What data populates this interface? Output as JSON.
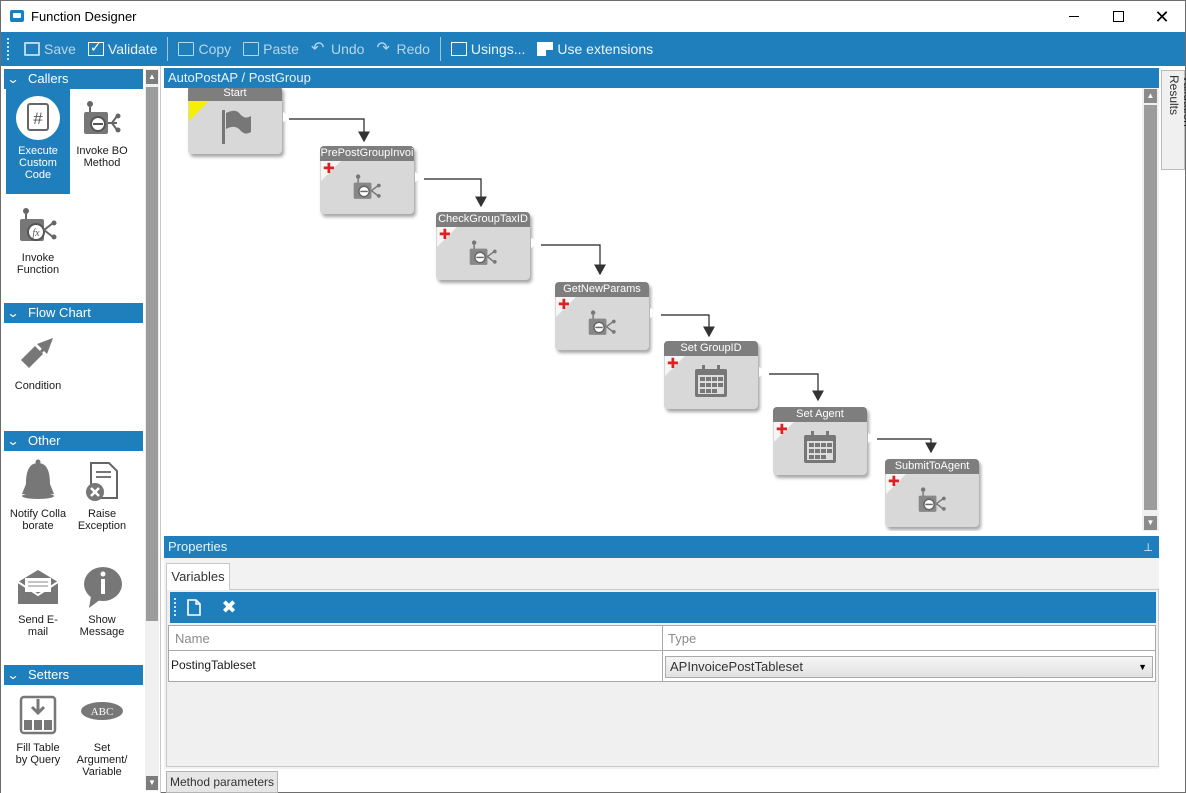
{
  "window": {
    "title": "Function Designer"
  },
  "toolbar": {
    "save": "Save",
    "validate": "Validate",
    "copy": "Copy",
    "paste": "Paste",
    "undo": "Undo",
    "redo": "Redo",
    "usings": "Usings...",
    "use_extensions": "Use extensions"
  },
  "toolbox": {
    "sections": {
      "callers": "Callers",
      "flow_chart": "Flow Chart",
      "other": "Other",
      "setters": "Setters"
    },
    "tools": {
      "execute_custom_code": "Execute Custom Code",
      "invoke_bo_method": "Invoke BO Method",
      "invoke_function": "Invoke Function",
      "condition": "Condition",
      "notify_collaborate": "Notify Collaborate",
      "raise_exception": "Raise Exception",
      "send_email": "Send E-mail",
      "show_message": "Show Message",
      "fill_table_by_query": "Fill Table by Query",
      "set_argument_variable": "Set Argument/ Variable"
    }
  },
  "designer": {
    "breadcrumb": "AutoPostAP / PostGroup",
    "nodes": {
      "start": "Start",
      "pre_post": "PrePostGroupInvoi",
      "check_tax": "CheckGroupTaxID",
      "get_params": "GetNewParams",
      "set_group": "Set GroupID",
      "set_agent": "Set Agent",
      "submit": "SubmitToAgent"
    }
  },
  "validation_tab": "Validation Results",
  "properties": {
    "title": "Properties",
    "tab_variables": "Variables",
    "columns": {
      "name": "Name",
      "type": "Type"
    },
    "row": {
      "name": "PostingTableset",
      "type": "APInvoicePostTableset"
    },
    "method_parameters_tab": "Method parameters"
  },
  "colors": {
    "accent": "#1f7fbd",
    "node_bg": "#d8d8d8",
    "node_title": "#7e7e7e"
  }
}
